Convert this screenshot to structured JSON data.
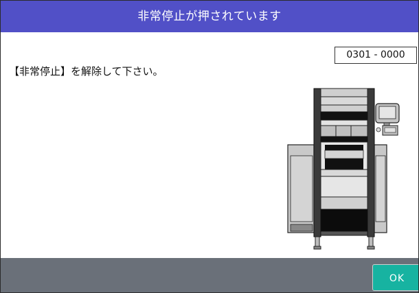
{
  "dialog": {
    "title": "非常停止が押されています",
    "error_code": "0301 - 0000",
    "message": "【非常停止】を解除して下さい。",
    "ok_label": "OK"
  },
  "colors": {
    "title_bar": "#5150c7",
    "bottom_bar": "#6a7079",
    "ok_button": "#17b3a1"
  }
}
